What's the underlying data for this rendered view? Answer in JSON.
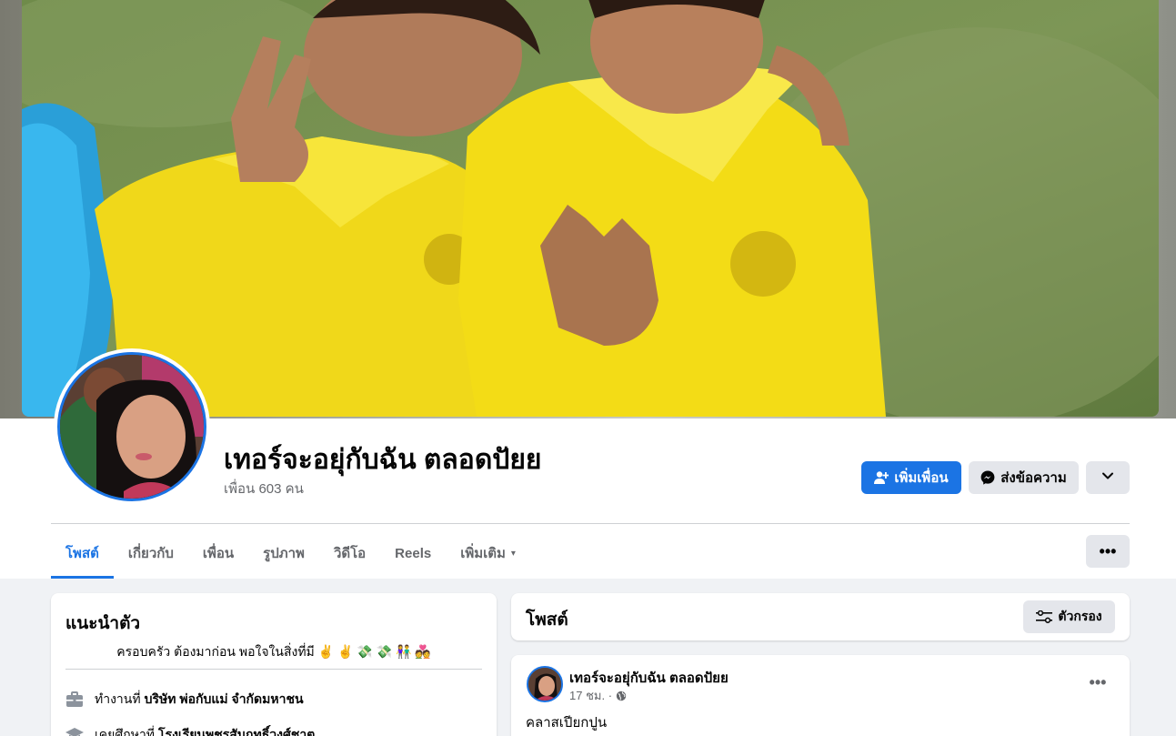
{
  "profile": {
    "name": "เทอร์จะอยุ่กับฉัน ตลอดปัยย",
    "friends_count": "เพื่อน 603 คน",
    "avatar_icon": "profile-photo",
    "cover_icon": "cover-photo"
  },
  "actions": {
    "add_friend_label": "เพิ่มเพื่อน",
    "add_friend_icon": "add-friend-icon",
    "message_label": "ส่งข้อความ",
    "message_icon": "messenger-icon",
    "more_icon": "chevron-down-icon"
  },
  "tabs": [
    {
      "label": "โพสต์",
      "active": true
    },
    {
      "label": "เกี่ยวกับ",
      "active": false
    },
    {
      "label": "เพื่อน",
      "active": false
    },
    {
      "label": "รูปภาพ",
      "active": false
    },
    {
      "label": "วิดีโอ",
      "active": false
    },
    {
      "label": "Reels",
      "active": false
    },
    {
      "label": "เพิ่มเติม",
      "active": false,
      "caret": "▾"
    }
  ],
  "tabs_more_label": "•••",
  "intro": {
    "title": "แนะนำตัว",
    "bio": "ครอบครัว ต้องมาก่อน พอใจในสิ่งที่มี ✌️ ✌️ 💸 💸 👫 💑",
    "work": {
      "prefix": "ทำงานที่",
      "value": "บริษัท พ่อกับแม่ จำกัดมหาชน",
      "icon": "briefcase-icon"
    },
    "education": {
      "prefix": "เคยศึกษาที่",
      "value": "โรงเรียนพชรสัมฤทธิ์วงศ์ชาตุ",
      "icon": "graduation-cap-icon"
    }
  },
  "posts": {
    "title": "โพสต์",
    "filter_label": "ตัวกรอง",
    "filter_icon": "filter-sliders-icon",
    "items": [
      {
        "author": "เทอร์จะอยุ่กับฉัน ตลอดปัยย",
        "time": "17 ชม. ·",
        "privacy_icon": "globe-icon",
        "text": "คลาสเปียกปูน",
        "more": "•••"
      }
    ]
  },
  "colors": {
    "accent": "#1b74e4",
    "secondary_button": "#e4e6eb",
    "page_background": "#f0f2f5",
    "muted_text": "#65676b"
  }
}
